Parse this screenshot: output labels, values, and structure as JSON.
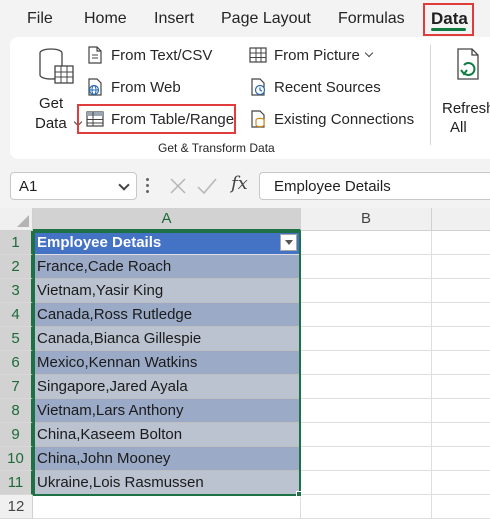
{
  "menu": {
    "tabs": [
      "File",
      "Home",
      "Insert",
      "Page Layout",
      "Formulas"
    ],
    "active_tab": "Data"
  },
  "ribbon": {
    "get_data": {
      "line1": "Get",
      "line2": "Data"
    },
    "from_text_csv": "From Text/CSV",
    "from_web": "From Web",
    "from_table_range": "From Table/Range",
    "from_picture": "From Picture",
    "recent_sources": "Recent Sources",
    "existing_connections": "Existing Connections",
    "refresh_all": {
      "line1": "Refresh",
      "line2": "All"
    },
    "group_label": "Get & Transform Data",
    "highlight_color": "#e03c3c"
  },
  "formula_bar": {
    "name_box": "A1",
    "formula": "Employee Details",
    "icons": [
      "cancel-icon",
      "enter-icon",
      "function-icon"
    ]
  },
  "sheet": {
    "columns": [
      "A",
      "B"
    ],
    "selected_column": "A",
    "rows": [
      "1",
      "2",
      "3",
      "4",
      "5",
      "6",
      "7",
      "8",
      "9",
      "10",
      "11",
      "12"
    ],
    "table": {
      "header": "Employee Details",
      "values": [
        "France,Cade Roach",
        "Vietnam,Yasir King",
        "Canada,Ross Rutledge",
        "Canada,Bianca Gillespie",
        "Mexico,Kennan Watkins",
        "Singapore,Jared Ayala",
        "Vietnam,Lars Anthony",
        "China,Kaseem Bolton",
        "China,John Mooney",
        "Ukraine,Lois Rasmussen"
      ],
      "header_color": "#4472c4",
      "band_colors": [
        "#d9e1f2",
        "#b4c6e7"
      ]
    },
    "selection_color": "#1e7145"
  }
}
